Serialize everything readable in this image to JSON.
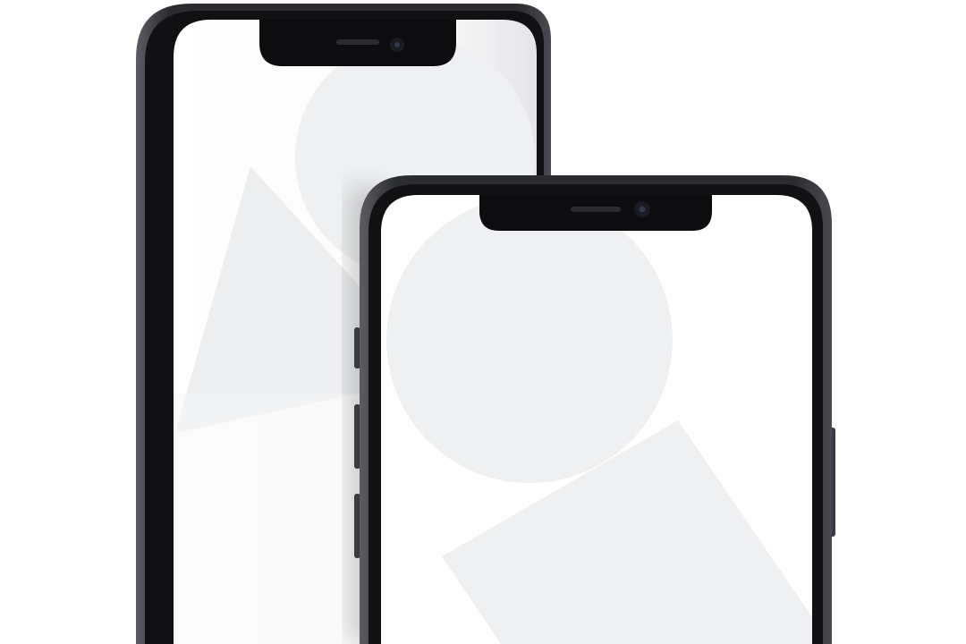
{
  "scene": {
    "background_color": "#ffffff",
    "devices": [
      {
        "name": "back-phone",
        "model_style": "notched smartphone",
        "frame_color": "#2b2c30",
        "screen_color": "#ffffff",
        "wallpaper_shapes": [
          "circle",
          "triangle"
        ],
        "wallpaper_shape_color": "#eef0f2"
      },
      {
        "name": "front-phone",
        "model_style": "notched smartphone",
        "frame_color": "#2b2c30",
        "screen_color": "#ffffff",
        "wallpaper_shapes": [
          "circle",
          "rotated-square"
        ],
        "wallpaper_shape_color": "#eef0f2"
      }
    ],
    "icons": [
      "speaker-grille-icon",
      "front-camera-icon",
      "side-button-icon"
    ]
  }
}
